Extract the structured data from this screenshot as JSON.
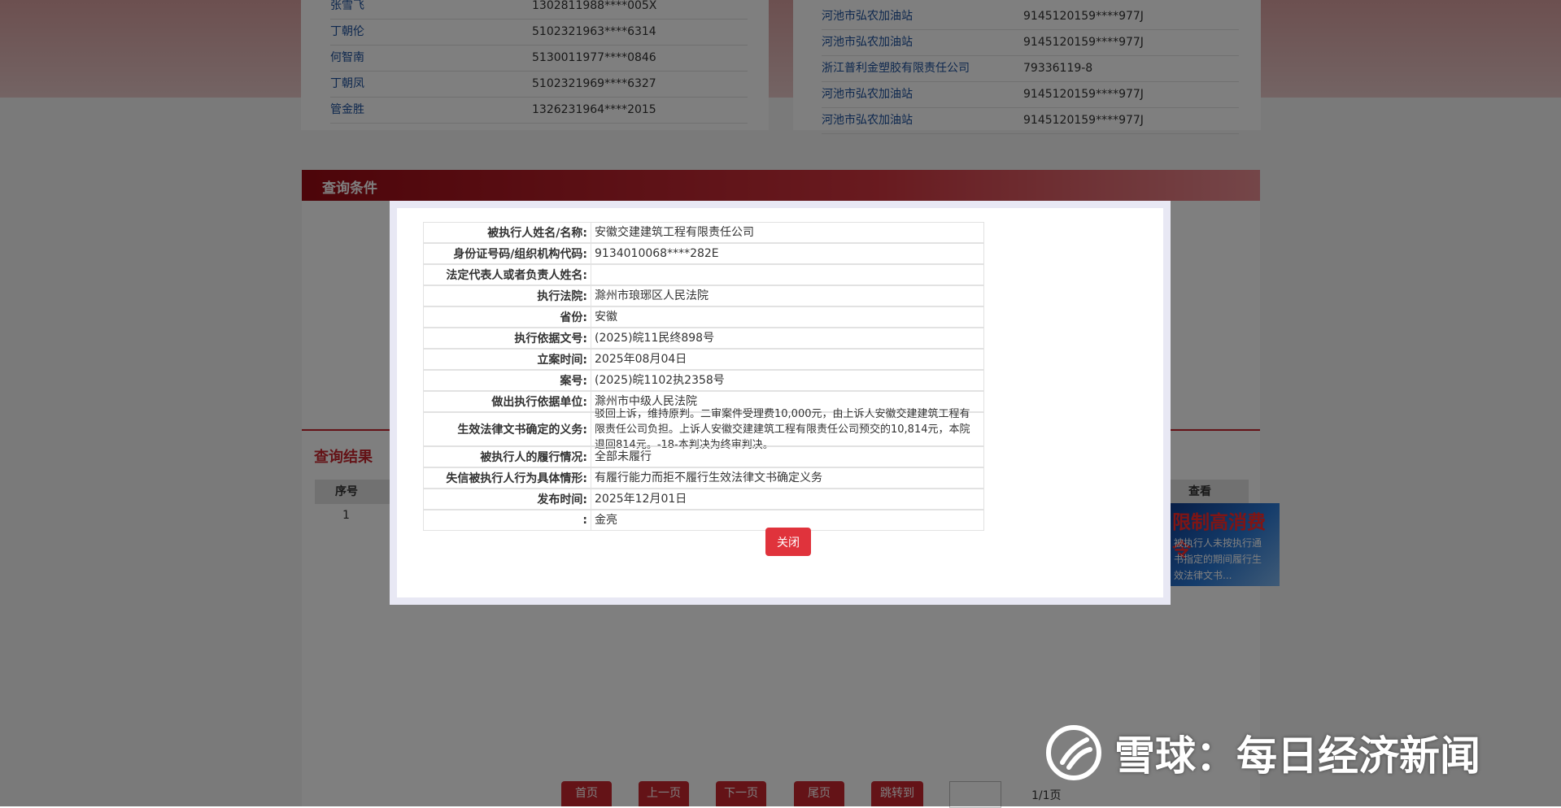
{
  "left_list": [
    {
      "name": "张雪飞",
      "id": "1302811988****005X"
    },
    {
      "name": "丁朝伦",
      "id": "5102321963****6314"
    },
    {
      "name": "何智南",
      "id": "5130011977****0846"
    },
    {
      "name": "丁朝凤",
      "id": "5102321969****6327"
    },
    {
      "name": "管金胜",
      "id": "1326231964****2015"
    }
  ],
  "right_list": [
    {
      "name": "河池市弘农加油站",
      "id": "9145120159****977J"
    },
    {
      "name": "河池市弘农加油站",
      "id": "9145120159****977J"
    },
    {
      "name": "浙江普利金塑胶有限责任公司",
      "id": "79336119-8"
    },
    {
      "name": "河池市弘农加油站",
      "id": "9145120159****977J"
    },
    {
      "name": "河池市弘农加油站",
      "id": "9145120159****977J"
    }
  ],
  "query_bar": {
    "title": "查询条件"
  },
  "results": {
    "title": "查询结果",
    "col_seq": "序号",
    "col_view": "查看",
    "row_seq": "1"
  },
  "ad": {
    "title": "限制高消费令",
    "lines": [
      "被执行人未按执行通",
      "书指定的期间履行生",
      "效法律文书..."
    ]
  },
  "pager": {
    "first": "首页",
    "prev": "上一页",
    "next": "下一页",
    "last": "尾页",
    "goto": "跳转到",
    "info": "1/1页"
  },
  "detail": {
    "rows": [
      {
        "label": "被执行人姓名/名称:",
        "value": "安徽交建建筑工程有限责任公司"
      },
      {
        "label": "身份证号码/组织机构代码:",
        "value": "9134010068****282E"
      },
      {
        "label": "法定代表人或者负责人姓名:",
        "value": ""
      },
      {
        "label": "执行法院:",
        "value": "滁州市琅琊区人民法院"
      },
      {
        "label": "省份:",
        "value": "安徽"
      },
      {
        "label": "执行依据文号:",
        "value": "(2025)皖11民终898号"
      },
      {
        "label": "立案时间:",
        "value": "2025年08月04日"
      },
      {
        "label": "案号:",
        "value": "(2025)皖1102执2358号"
      },
      {
        "label": "做出执行依据单位:",
        "value": "滁州市中级人民法院"
      },
      {
        "label": "生效法律文书确定的义务:",
        "value": "驳回上诉，维持原判。二审案件受理费10,000元，由上诉人安徽交建建筑工程有限责任公司负担。上诉人安徽交建建筑工程有限责任公司预交的10,814元，本院退回814元。-18-本判决为终审判决。"
      },
      {
        "label": "被执行人的履行情况:",
        "value": "全部未履行"
      },
      {
        "label": "失信被执行人行为具体情形:",
        "value": "有履行能力而拒不履行生效法律文书确定义务"
      },
      {
        "label": "发布时间:",
        "value": "2025年12月01日"
      },
      {
        "label": ":",
        "value": "金亮"
      }
    ],
    "close": "关闭"
  },
  "watermark": {
    "text": "雪球：每日经济新闻"
  }
}
